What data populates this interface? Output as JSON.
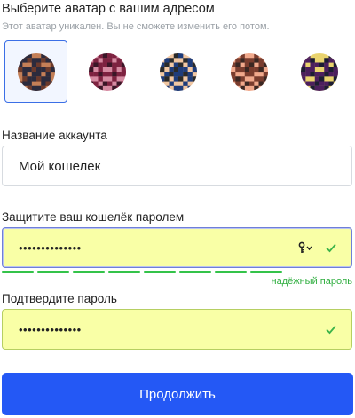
{
  "header": {
    "title": "Выберите аватар с вашим адресом",
    "subtitle": "Этот аватар уникален. Вы не сможете изменить его потом."
  },
  "avatars": [
    {
      "selected": true,
      "bg": "#c47f57",
      "fg": "#2c2b3d",
      "accent": "#6b3a2c"
    },
    {
      "selected": false,
      "bg": "#d58aa1",
      "fg": "#7d2240",
      "accent": "#3b1627"
    },
    {
      "selected": false,
      "bg": "#f1c7a2",
      "fg": "#1e3c7b",
      "accent": "#2a2a2a"
    },
    {
      "selected": false,
      "bg": "#f0a98c",
      "fg": "#7a3d2e",
      "accent": "#3b2722"
    },
    {
      "selected": false,
      "bg": "#e9d36e",
      "fg": "#4c1f5e",
      "accent": "#1d1d33"
    }
  ],
  "account": {
    "label": "Название аккаунта",
    "value": "Мой кошелек"
  },
  "password": {
    "label": "Защитите ваш кошелёк паролем",
    "value": "••••••••••••••",
    "strength_segments": 8,
    "strength_label": "надёжный пароль"
  },
  "confirm": {
    "label": "Подтвердите пароль",
    "value": "••••••••••••••"
  },
  "continue_label": "Продолжить",
  "colors": {
    "accent": "#2458f5",
    "valid_bg": "#f9ffa6",
    "strength": "#34c34a"
  },
  "icons": {
    "check": "check-icon",
    "key": "key-icon"
  }
}
